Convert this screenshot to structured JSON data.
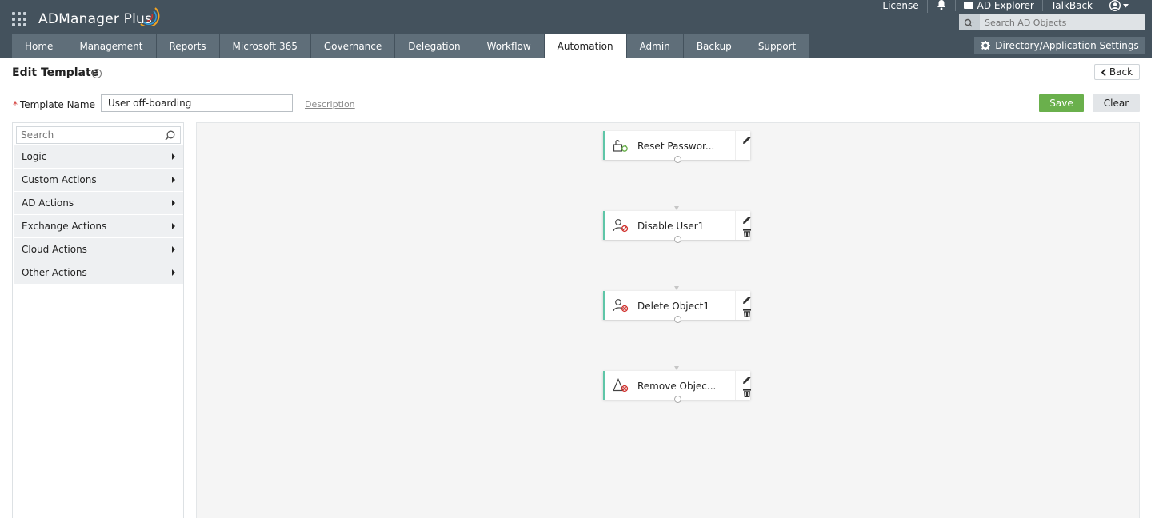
{
  "header": {
    "brand": "ADManager Plus",
    "top_links": {
      "license": "License",
      "ad_explorer": "AD Explorer",
      "talkback": "TalkBack"
    },
    "search_placeholder": "Search AD Objects",
    "tabs": [
      {
        "label": "Home",
        "active": false
      },
      {
        "label": "Management",
        "active": false
      },
      {
        "label": "Reports",
        "active": false
      },
      {
        "label": "Microsoft 365",
        "active": false
      },
      {
        "label": "Governance",
        "active": false
      },
      {
        "label": "Delegation",
        "active": false
      },
      {
        "label": "Workflow",
        "active": false
      },
      {
        "label": "Automation",
        "active": true
      },
      {
        "label": "Admin",
        "active": false
      },
      {
        "label": "Backup",
        "active": false
      },
      {
        "label": "Support",
        "active": false
      }
    ],
    "settings_button": "Directory/Application Settings"
  },
  "page": {
    "title": "Edit Template",
    "help": "?",
    "back": "Back",
    "template_name_label": "Template Name",
    "template_name_value": "User off-boarding",
    "description_link": "Description",
    "save": "Save",
    "clear": "Clear"
  },
  "left_panel": {
    "search_placeholder": "Search",
    "items": [
      {
        "label": "Logic"
      },
      {
        "label": "Custom Actions"
      },
      {
        "label": "AD Actions"
      },
      {
        "label": "Exchange Actions"
      },
      {
        "label": "Cloud Actions"
      },
      {
        "label": "Other Actions"
      }
    ]
  },
  "workflow": {
    "nodes": [
      {
        "label": "Reset Passwor...",
        "icon": "unlock-icon",
        "deletable": false
      },
      {
        "label": "Disable User1",
        "icon": "user-disable-icon",
        "deletable": true
      },
      {
        "label": "Delete Object1",
        "icon": "user-delete-icon",
        "deletable": true
      },
      {
        "label": "Remove Objec...",
        "icon": "remove-object-icon",
        "deletable": true
      }
    ]
  },
  "colors": {
    "header_bg": "#44525d",
    "tab_bg": "#5f6e79",
    "save_green": "#6ab04c",
    "node_accent": "#5fc6a8"
  }
}
